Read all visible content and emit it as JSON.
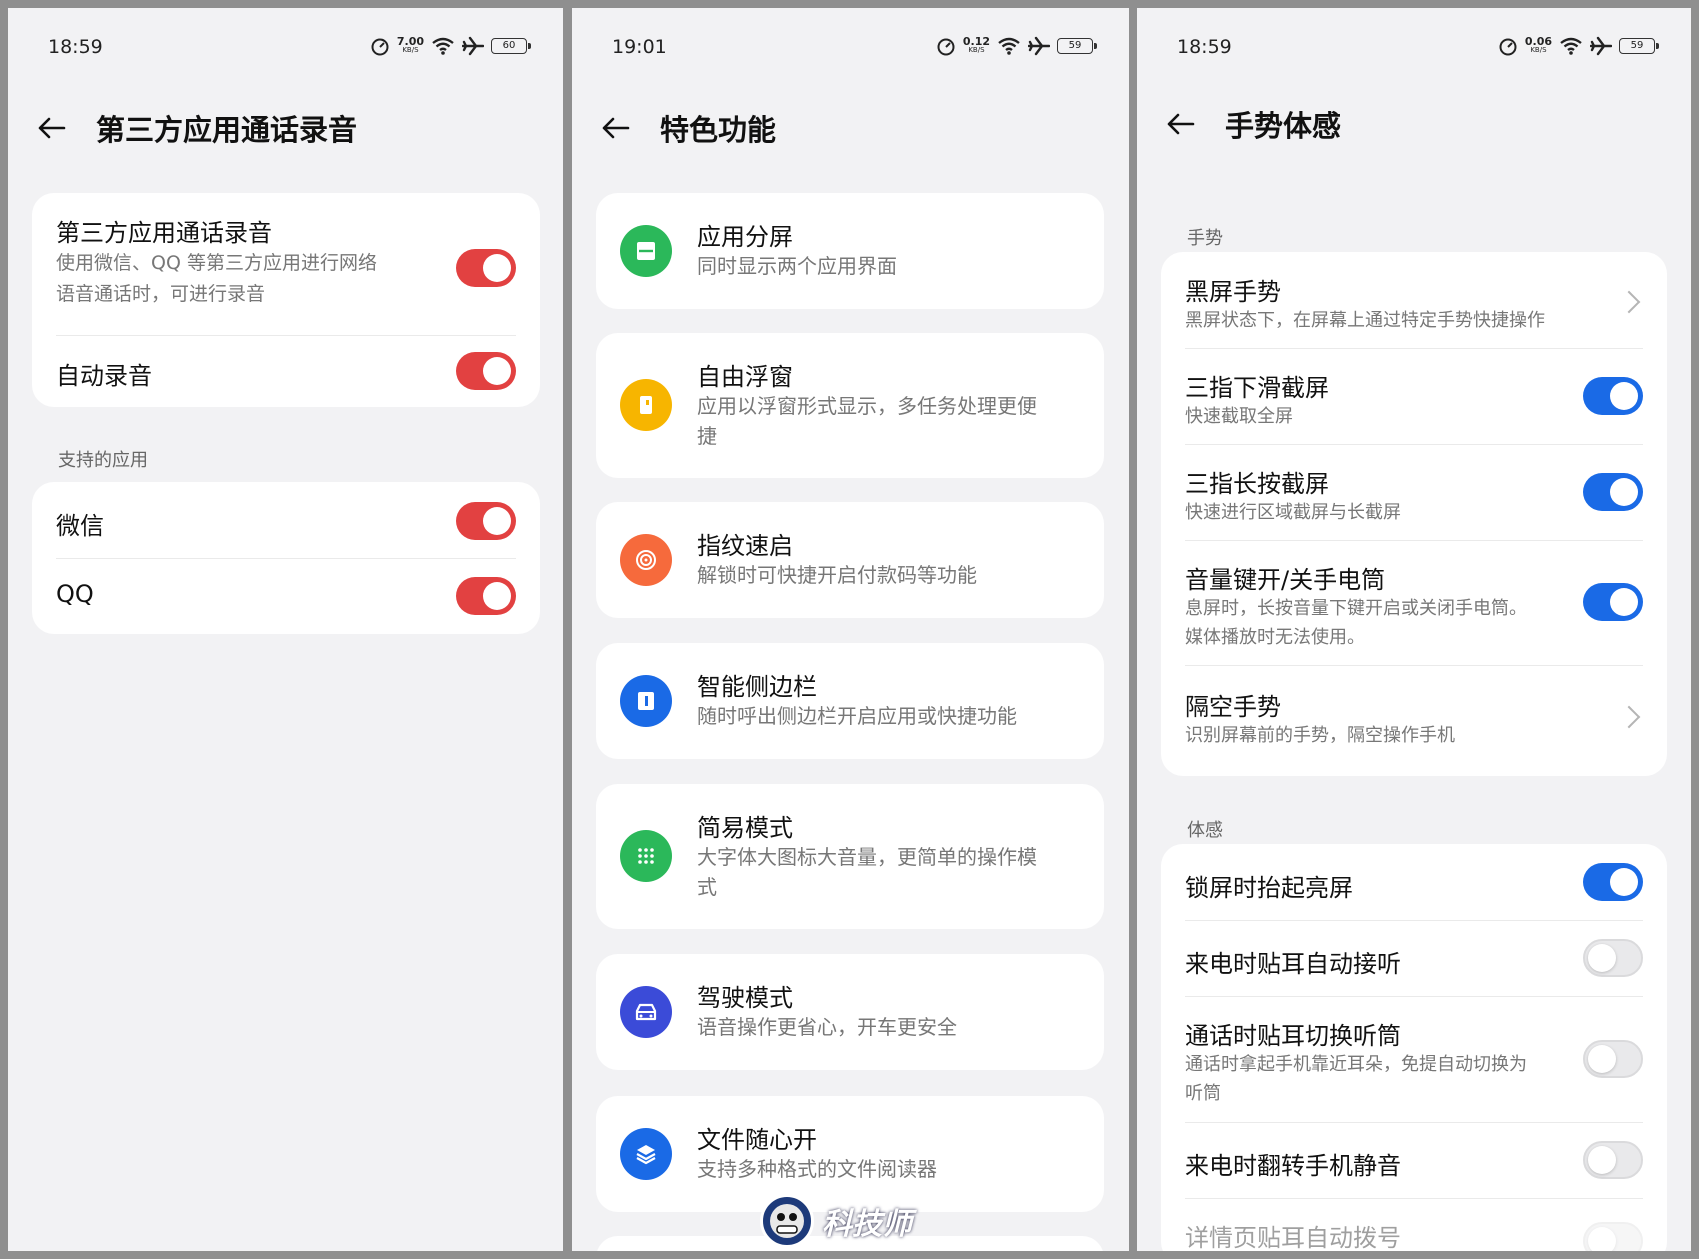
{
  "screen1": {
    "status": {
      "time": "18:59",
      "speed": "7.00",
      "speed_unit": "KB/S",
      "battery": "60"
    },
    "title": "第三方应用通话录音",
    "rows": [
      {
        "title": "第三方应用通话录音",
        "desc_line1": "使用微信、QQ 等第三方应用进行网络",
        "desc_line2": "语音通话时，可进行录音"
      },
      {
        "title": "自动录音"
      }
    ],
    "section_label": "支持的应用",
    "apps": [
      {
        "title": "微信"
      },
      {
        "title": "QQ"
      }
    ],
    "accent": "#e24141"
  },
  "screen2": {
    "status": {
      "time": "19:01",
      "speed": "0.12",
      "speed_unit": "KB/S",
      "battery": "59"
    },
    "title": "特色功能",
    "items": [
      {
        "title": "应用分屏",
        "desc_line1": "同时显示两个应用界面",
        "color": "#2bb85a"
      },
      {
        "title": "自由浮窗",
        "desc_line1": "应用以浮窗形式显示，多任务处理更便",
        "desc_line2": "捷",
        "color": "#f7b500"
      },
      {
        "title": "指纹速启",
        "desc_line1": "解锁时可快捷开启付款码等功能",
        "color": "#f66a3c"
      },
      {
        "title": "智能侧边栏",
        "desc_line1": "随时呼出侧边栏开启应用或快捷功能",
        "color": "#1a6ae6"
      },
      {
        "title": "简易模式",
        "desc_line1": "大字体大图标大音量，更简单的操作模",
        "desc_line2": "式",
        "color": "#2bb85a"
      },
      {
        "title": "驾驶模式",
        "desc_line1": "语音操作更省心，开车更安全",
        "color": "#3b4bd8"
      },
      {
        "title": "文件随心开",
        "desc_line1": "支持多种格式的文件阅读器",
        "color": "#1a6ae6"
      }
    ]
  },
  "screen3": {
    "status": {
      "time": "18:59",
      "speed": "0.06",
      "speed_unit": "KB/S",
      "battery": "59"
    },
    "title": "手势体感",
    "section1": "手势",
    "gestures": [
      {
        "title": "黑屏手势",
        "desc_line1": "黑屏状态下，在屏幕上通过特定手势快捷操作"
      },
      {
        "title": "三指下滑截屏",
        "desc_line1": "快速截取全屏"
      },
      {
        "title": "三指长按截屏",
        "desc_line1": "快速进行区域截屏与长截屏"
      },
      {
        "title": "音量键开/关手电筒",
        "desc_line1": "息屏时，长按音量下键开启或关闭手电筒。",
        "desc_line2": "媒体播放时无法使用。"
      },
      {
        "title": "隔空手势",
        "desc_line1": "识别屏幕前的手势，隔空操作手机"
      }
    ],
    "section2": "体感",
    "motions": [
      {
        "title": "锁屏时抬起亮屏"
      },
      {
        "title": "来电时贴耳自动接听"
      },
      {
        "title": "通话时贴耳切换听筒",
        "desc_line1": "通话时拿起手机靠近耳朵，免提自动切换为",
        "desc_line2": "听筒"
      },
      {
        "title": "来电时翻转手机静音"
      },
      {
        "title": "详情页贴耳自动拨号"
      }
    ],
    "accent": "#1a6ae6"
  },
  "watermark": {
    "text": "科技师"
  }
}
